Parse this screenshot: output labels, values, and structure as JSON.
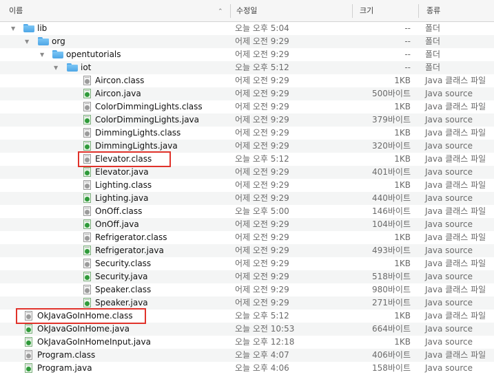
{
  "columns": {
    "name": "이름",
    "modified": "수정일",
    "size": "크기",
    "kind": "종류"
  },
  "rows": [
    {
      "name": "lib",
      "date": "오늘 오후 5:04",
      "size": "--",
      "kind": "폴더",
      "type": "folder",
      "level": 0,
      "expanded": true
    },
    {
      "name": "org",
      "date": "어제 오전 9:29",
      "size": "--",
      "kind": "폴더",
      "type": "folder",
      "level": 1,
      "expanded": true
    },
    {
      "name": "opentutorials",
      "date": "어제 오전 9:29",
      "size": "--",
      "kind": "폴더",
      "type": "folder",
      "level": 2,
      "expanded": true
    },
    {
      "name": "iot",
      "date": "오늘 오후 5:12",
      "size": "--",
      "kind": "폴더",
      "type": "folder",
      "level": 3,
      "expanded": true
    },
    {
      "name": "Aircon.class",
      "date": "어제 오전 9:29",
      "size": "1KB",
      "kind": "Java 클래스 파일",
      "type": "class",
      "level": 4
    },
    {
      "name": "Aircon.java",
      "date": "어제 오전 9:29",
      "size": "500바이트",
      "kind": "Java source",
      "type": "java",
      "level": 4
    },
    {
      "name": "ColorDimmingLights.class",
      "date": "어제 오전 9:29",
      "size": "1KB",
      "kind": "Java 클래스 파일",
      "type": "class",
      "level": 4
    },
    {
      "name": "ColorDimmingLights.java",
      "date": "어제 오전 9:29",
      "size": "379바이트",
      "kind": "Java source",
      "type": "java",
      "level": 4
    },
    {
      "name": "DimmingLights.class",
      "date": "어제 오전 9:29",
      "size": "1KB",
      "kind": "Java 클래스 파일",
      "type": "class",
      "level": 4
    },
    {
      "name": "DimmingLights.java",
      "date": "어제 오전 9:29",
      "size": "320바이트",
      "kind": "Java source",
      "type": "java",
      "level": 4
    },
    {
      "name": "Elevator.class",
      "date": "오늘 오후 5:12",
      "size": "1KB",
      "kind": "Java 클래스 파일",
      "type": "class",
      "level": 4
    },
    {
      "name": "Elevator.java",
      "date": "어제 오전 9:29",
      "size": "401바이트",
      "kind": "Java source",
      "type": "java",
      "level": 4
    },
    {
      "name": "Lighting.class",
      "date": "어제 오전 9:29",
      "size": "1KB",
      "kind": "Java 클래스 파일",
      "type": "class",
      "level": 4
    },
    {
      "name": "Lighting.java",
      "date": "어제 오전 9:29",
      "size": "440바이트",
      "kind": "Java source",
      "type": "java",
      "level": 4
    },
    {
      "name": "OnOff.class",
      "date": "오늘 오후 5:00",
      "size": "146바이트",
      "kind": "Java 클래스 파일",
      "type": "class",
      "level": 4
    },
    {
      "name": "OnOff.java",
      "date": "어제 오전 9:29",
      "size": "104바이트",
      "kind": "Java source",
      "type": "java",
      "level": 4
    },
    {
      "name": "Refrigerator.class",
      "date": "어제 오전 9:29",
      "size": "1KB",
      "kind": "Java 클래스 파일",
      "type": "class",
      "level": 4
    },
    {
      "name": "Refrigerator.java",
      "date": "어제 오전 9:29",
      "size": "493바이트",
      "kind": "Java source",
      "type": "java",
      "level": 4
    },
    {
      "name": "Security.class",
      "date": "어제 오전 9:29",
      "size": "1KB",
      "kind": "Java 클래스 파일",
      "type": "class",
      "level": 4
    },
    {
      "name": "Security.java",
      "date": "어제 오전 9:29",
      "size": "518바이트",
      "kind": "Java source",
      "type": "java",
      "level": 4
    },
    {
      "name": "Speaker.class",
      "date": "어제 오전 9:29",
      "size": "980바이트",
      "kind": "Java 클래스 파일",
      "type": "class",
      "level": 4
    },
    {
      "name": "Speaker.java",
      "date": "어제 오전 9:29",
      "size": "271바이트",
      "kind": "Java source",
      "type": "java",
      "level": 4
    },
    {
      "name": "OkJavaGoInHome.class",
      "date": "오늘 오후 5:12",
      "size": "1KB",
      "kind": "Java 클래스 파일",
      "type": "class",
      "level": 0
    },
    {
      "name": "OkJavaGoInHome.java",
      "date": "오늘 오전 10:53",
      "size": "664바이트",
      "kind": "Java source",
      "type": "java",
      "level": 0
    },
    {
      "name": "OkJavaGoInHomeInput.java",
      "date": "오늘 오후 12:18",
      "size": "1KB",
      "kind": "Java source",
      "type": "java",
      "level": 0
    },
    {
      "name": "Program.class",
      "date": "오늘 오후 4:07",
      "size": "406바이트",
      "kind": "Java 클래스 파일",
      "type": "class",
      "level": 0
    },
    {
      "name": "Program.java",
      "date": "오늘 오후 4:06",
      "size": "158바이트",
      "kind": "Java source",
      "type": "java",
      "level": 0
    }
  ],
  "highlighted": [
    "Elevator.class",
    "OkJavaGoInHome.class"
  ],
  "colors": {
    "highlight": "#e0322a",
    "folder": "#5eb3ef",
    "java_icon": "#2f9a3a"
  }
}
